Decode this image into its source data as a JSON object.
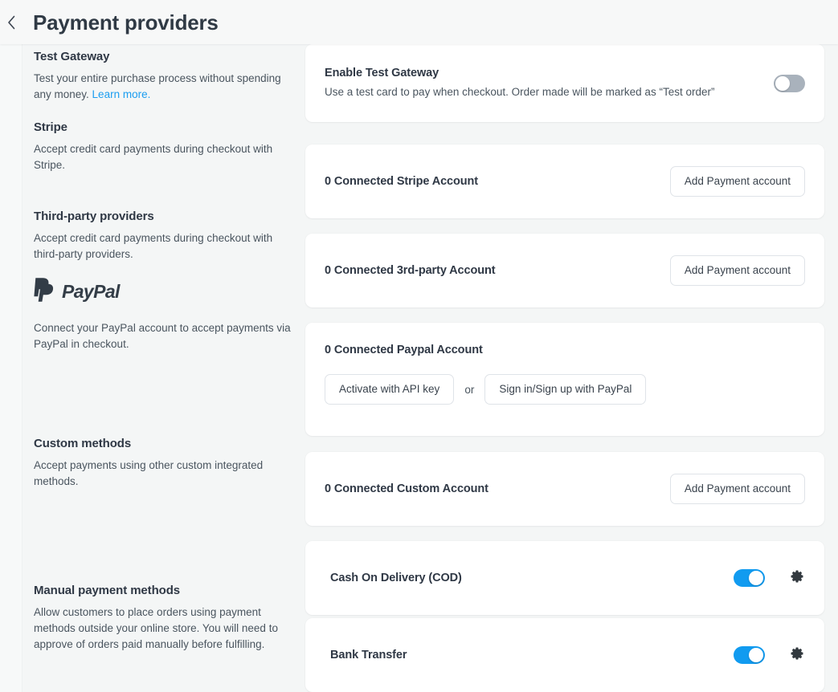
{
  "header": {
    "back_icon": "chevron-left-icon",
    "title": "Payment providers"
  },
  "sections": [
    {
      "key": "test_gateway",
      "title": "Test Gateway",
      "desc": "Test your entire purchase process without spending any money. ",
      "link": "Learn more."
    },
    {
      "key": "stripe",
      "title": "Stripe",
      "desc": "Accept credit card payments during checkout with Stripe."
    },
    {
      "key": "third_party",
      "title": "Third-party providers",
      "desc": "Accept credit card payments during checkout with third-party providers."
    },
    {
      "key": "paypal",
      "logo": "paypal-logo",
      "title": "PayPal",
      "desc": "Connect your PayPal account to accept payments via PayPal in checkout."
    },
    {
      "key": "custom",
      "title": "Custom methods",
      "desc": "Accept payments using other custom integrated methods."
    },
    {
      "key": "manual",
      "title": "Manual payment methods",
      "desc": "Allow customers to place orders using payment methods outside your online store. You will need to approve of orders paid manually before fulfilling."
    }
  ],
  "cards": {
    "test_gateway": {
      "title": "Enable Test Gateway",
      "subtitle": "Use a test card to pay when checkout. Order made will be marked as “Test order”",
      "toggle_state": "off"
    },
    "stripe": {
      "title": "0 Connected Stripe Account",
      "button": "Add Payment account"
    },
    "third_party": {
      "title": "0 Connected 3rd-party Account",
      "button": "Add Payment account"
    },
    "paypal": {
      "title": "0 Connected Paypal Account",
      "button_primary": "Activate with API key",
      "or": "or",
      "button_secondary": "Sign in/Sign up with PayPal"
    },
    "custom": {
      "title": "0 Connected Custom Account",
      "button": "Add Payment account"
    },
    "cod": {
      "title": "Cash On Delivery (COD)",
      "toggle_state": "on",
      "gear_icon": "gear-icon"
    },
    "bank_transfer": {
      "title": "Bank Transfer",
      "toggle_state": "on",
      "gear_icon": "gear-icon"
    }
  },
  "colors": {
    "background": "#f4f6f6",
    "card": "#ffffff",
    "accent_blue": "#119bf0",
    "link_blue": "#1b9df0",
    "toggle_off": "#a9b2bc",
    "text_primary": "#2f3845",
    "text_secondary": "#4a555f"
  }
}
